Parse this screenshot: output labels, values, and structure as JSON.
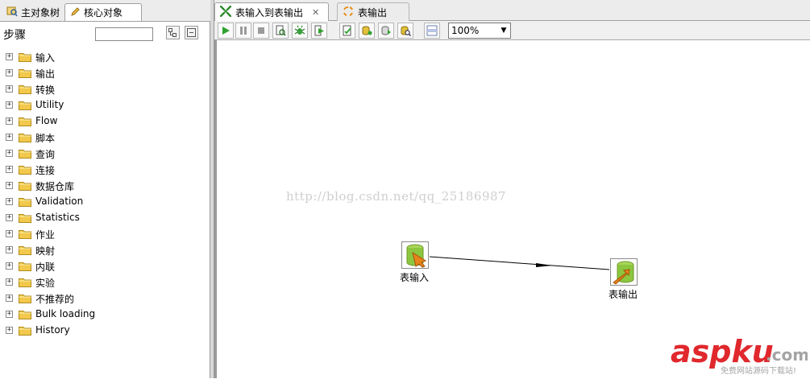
{
  "left_panel": {
    "tabs": [
      {
        "label": "主对象树",
        "icon": "object-tree-icon"
      },
      {
        "label": "核心对象",
        "icon": "pencil-icon"
      }
    ],
    "steps_title": "步骤",
    "search": {
      "value": "",
      "placeholder": ""
    },
    "tree_items": [
      {
        "label": "输入"
      },
      {
        "label": "输出"
      },
      {
        "label": "转换"
      },
      {
        "label": "Utility"
      },
      {
        "label": "Flow"
      },
      {
        "label": "脚本"
      },
      {
        "label": "查询"
      },
      {
        "label": "连接"
      },
      {
        "label": "数据仓库"
      },
      {
        "label": "Validation"
      },
      {
        "label": "Statistics"
      },
      {
        "label": "作业"
      },
      {
        "label": "映射"
      },
      {
        "label": "内联"
      },
      {
        "label": "实验"
      },
      {
        "label": "不推荐的"
      },
      {
        "label": "Bulk loading"
      },
      {
        "label": "History"
      }
    ]
  },
  "editor": {
    "tabs": [
      {
        "label": "表输入到表输出",
        "icon": "transformation-icon",
        "closable": true
      },
      {
        "label": "表输出",
        "icon": "job-icon",
        "closable": false
      }
    ],
    "toolbar": {
      "buttons": [
        "run-icon",
        "pause-icon",
        "stop-icon",
        "preview-icon",
        "debug-icon",
        "replay-icon",
        "verify-icon",
        "impact-icon",
        "sql-icon",
        "explore-db-icon",
        "grid-icon"
      ],
      "zoom": "100%"
    },
    "canvas": {
      "watermark": "http://blog.csdn.net/qq_25186987",
      "steps": [
        {
          "label": "表输入"
        },
        {
          "label": "表输出"
        }
      ]
    }
  },
  "site_logo": {
    "text": "aspku",
    "suffix": ".com",
    "tagline": "免费网站源码下载站!"
  },
  "colors": {
    "folder": "#f2c94c",
    "run_green": "#2fa12f",
    "logo_red": "#e0282d",
    "logo_gray": "#a5a5a5"
  }
}
